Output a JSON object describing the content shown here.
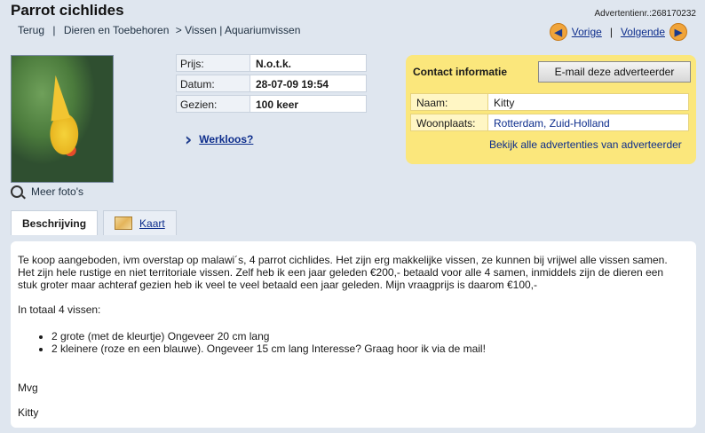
{
  "header": {
    "title": "Parrot cichlides",
    "ad_number": "Advertentienr.:268170232",
    "breadcrumb": {
      "back": "Terug",
      "category": "Dieren en Toebehoren",
      "sub": "> Vissen | Aquariumvissen"
    },
    "pager": {
      "prev": "Vorige",
      "next": "Volgende"
    }
  },
  "photo": {
    "more_label": "Meer foto's",
    "icon": "zoom-icon"
  },
  "details": {
    "rows": [
      {
        "label": "Prijs:",
        "value": "N.o.t.k."
      },
      {
        "label": "Datum:",
        "value": "28-07-09 19:54"
      },
      {
        "label": "Gezien:",
        "value": "100 keer"
      }
    ],
    "werkloos_link": "Werkloos?"
  },
  "contact": {
    "heading": "Contact informatie",
    "email_button": "E-mail deze adverteerder",
    "rows": [
      {
        "label": "Naam:",
        "value": "Kitty"
      },
      {
        "label": "Woonplaats:",
        "value": "Rotterdam, Zuid-Holland"
      }
    ],
    "all_ads_link": "Bekijk alle advertenties van adverteerder"
  },
  "tabs": [
    {
      "label": "Beschrijving",
      "active": true
    },
    {
      "label": "Kaart",
      "active": false
    }
  ],
  "description": {
    "para1": "Te koop aangeboden, ivm overstap op malawi´s, 4 parrot cichlides. Het zijn erg makkelijke vissen, ze kunnen bij vrijwel alle vissen samen. Het zijn hele rustige en niet territoriale vissen. Zelf heb ik een jaar geleden €200,- betaald voor alle 4 samen, inmiddels zijn de dieren een stuk groter maar achteraf gezien heb ik veel te veel betaald een jaar geleden. Mijn vraagprijs is daarom €100,-",
    "para2": "In totaal 4 vissen:",
    "bullets": [
      "2 grote (met de kleurtje) Ongeveer 20 cm lang",
      "2 kleinere (roze en een blauwe). Ongeveer 15 cm lang Interesse? Graag hoor ik via de mail!"
    ],
    "closing": "Mvg",
    "signature": "Kitty"
  }
}
